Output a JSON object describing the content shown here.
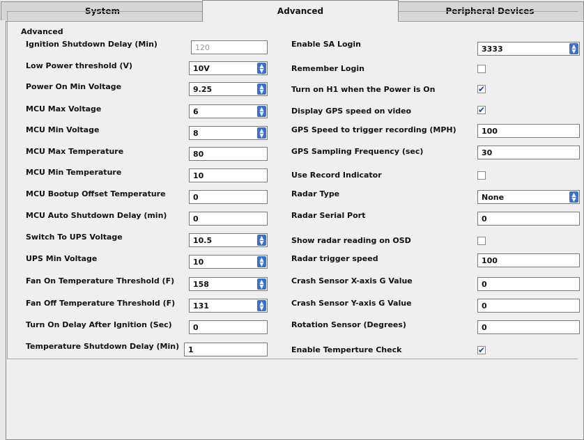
{
  "tabs": [
    "System",
    "Advanced",
    "Peripheral Devices"
  ],
  "group_label": "Advanced",
  "left": {
    "ignition_shutdown_delay": {
      "label": "Ignition Shutdown Delay (Min)",
      "value": "120"
    },
    "low_power_threshold": {
      "label": "Low Power threshold (V)",
      "value": "10V"
    },
    "power_on_min_voltage": {
      "label": "Power On Min Voltage",
      "value": "9.25"
    },
    "mcu_max_voltage": {
      "label": "MCU Max Voltage",
      "value": "6"
    },
    "mcu_min_voltage": {
      "label": "MCU Min Voltage",
      "value": "8"
    },
    "mcu_max_temperature": {
      "label": "MCU Max Temperature",
      "value": "80"
    },
    "mcu_min_temperature": {
      "label": "MCU Min Temperature",
      "value": "10"
    },
    "mcu_bootup_offset_temperature": {
      "label": "MCU Bootup Offset Temperature",
      "value": "0"
    },
    "mcu_auto_shutdown_delay": {
      "label": "MCU Auto Shutdown Delay (min)",
      "value": "0"
    },
    "switch_to_ups_voltage": {
      "label": "Switch To UPS Voltage",
      "value": "10.5"
    },
    "ups_min_voltage": {
      "label": "UPS Min Voltage",
      "value": "10"
    },
    "fan_on_threshold": {
      "label": "Fan On Temperature Threshold (F)",
      "value": "158"
    },
    "fan_off_threshold": {
      "label": "Fan Off Temperature Threshold (F)",
      "value": "131"
    },
    "turn_on_delay_after_ignition": {
      "label": "Turn On Delay After Ignition (Sec)",
      "value": "0"
    },
    "temperature_shutdown_delay": {
      "label": "Temperature Shutdown Delay (Min)",
      "value": "1"
    }
  },
  "right": {
    "enable_sa_login": {
      "label": "Enable SA Login",
      "value": "3333"
    },
    "remember_login": {
      "label": "Remember Login",
      "checked": false
    },
    "turn_on_h1": {
      "label": "Turn on H1 when the Power is On",
      "checked": true
    },
    "display_gps_speed": {
      "label": "Display GPS speed on video",
      "checked": true
    },
    "gps_speed_trigger": {
      "label": "GPS Speed to trigger recording (MPH)",
      "value": "100"
    },
    "gps_sampling_frequency": {
      "label": "GPS Sampling Frequency (sec)",
      "value": "30"
    },
    "use_record_indicator": {
      "label": "Use Record Indicator",
      "checked": false
    },
    "radar_type": {
      "label": "Radar Type",
      "value": "None"
    },
    "radar_serial_port": {
      "label": "Radar Serial Port",
      "value": "0"
    },
    "show_radar_reading": {
      "label": "Show radar reading on OSD",
      "checked": false
    },
    "radar_trigger_speed": {
      "label": "Radar trigger speed",
      "value": "100"
    },
    "crash_sensor_x": {
      "label": "Crash Sensor X-axis G Value",
      "value": "0"
    },
    "crash_sensor_y": {
      "label": "Crash Sensor Y-axis G Value",
      "value": "0"
    },
    "rotation_sensor": {
      "label": "Rotation Sensor (Degrees)",
      "value": "0"
    },
    "enable_temperature_check": {
      "label": "Enable Temperture Check",
      "checked": true
    }
  },
  "icons": {
    "dropdown": "updown-arrow-icon",
    "checkmark": "checkmark-icon"
  }
}
